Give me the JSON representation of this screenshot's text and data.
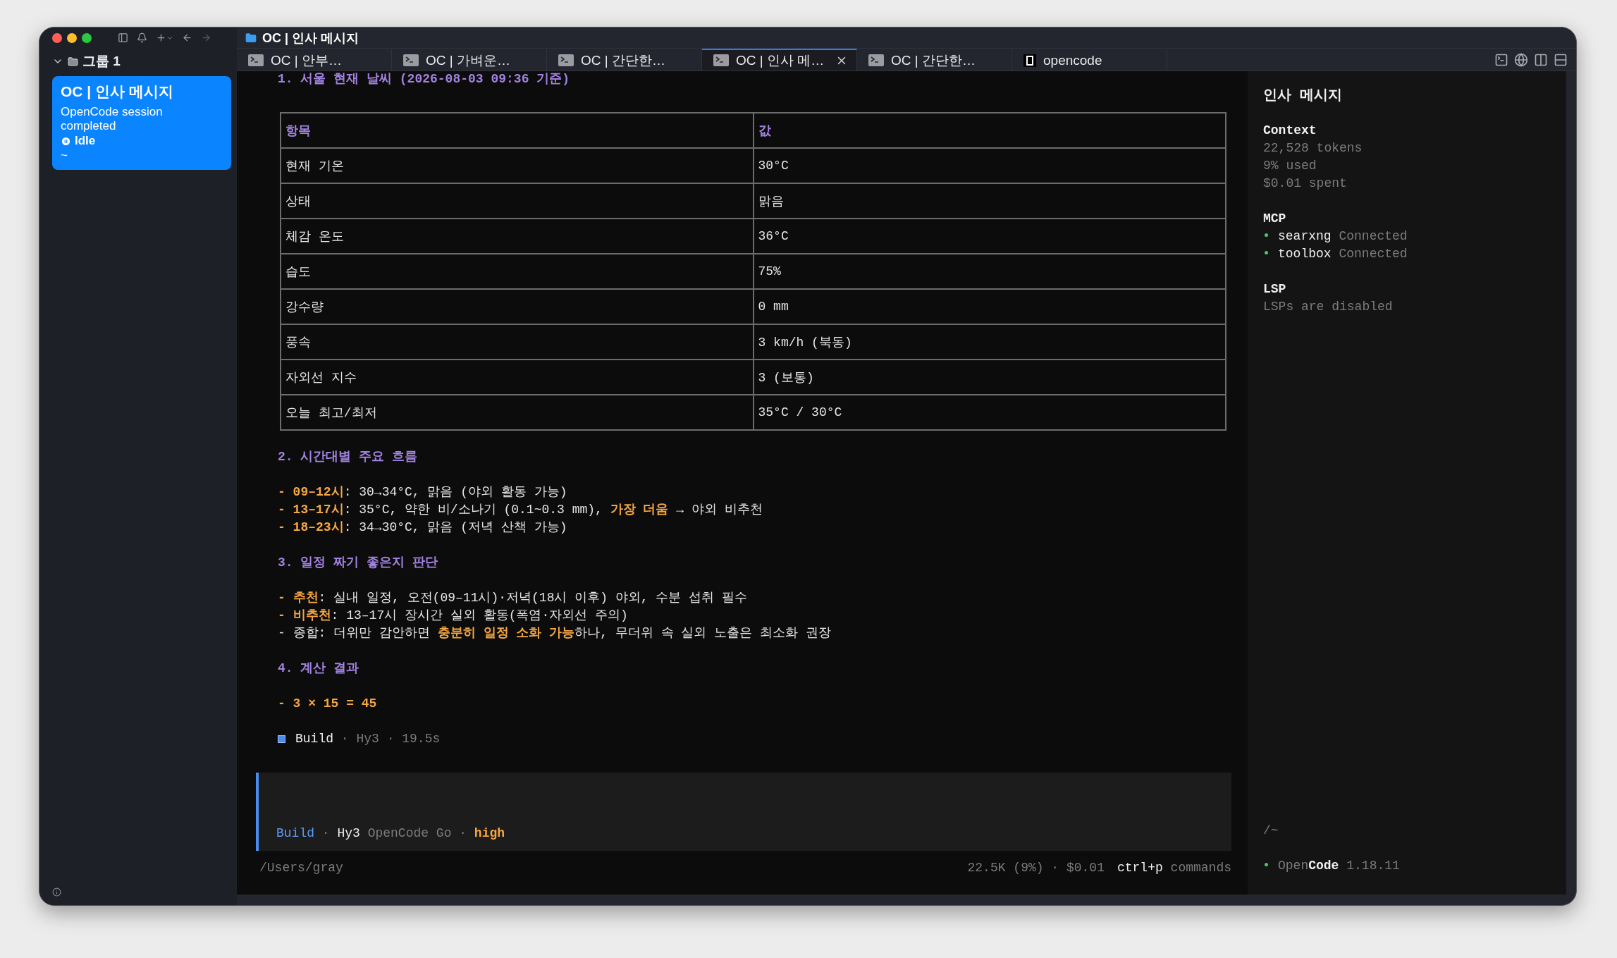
{
  "window": {
    "title": "OC | 인사 메시지"
  },
  "sidebar": {
    "group": {
      "label": "그룹 1",
      "expanded": true
    },
    "sessions": [
      {
        "title": "OC | 인사 메시지",
        "status_text": "OpenCode session completed",
        "state": "Idle",
        "path": "~",
        "selected": true
      }
    ]
  },
  "tabs": [
    {
      "label": "OC | 안부…",
      "kind": "terminal",
      "selected": false
    },
    {
      "label": "OC | 가벼운…",
      "kind": "terminal",
      "selected": false
    },
    {
      "label": "OC | 간단한…",
      "kind": "terminal",
      "selected": false
    },
    {
      "label": "OC | 인사 메…",
      "kind": "terminal",
      "selected": true
    },
    {
      "label": "OC | 간단한…",
      "kind": "terminal",
      "selected": false
    },
    {
      "label": "opencode",
      "kind": "app",
      "selected": false
    }
  ],
  "transcript": {
    "sections": [
      {
        "heading": "1. 서울 현재 날씨 (2026-08-03 09:36 기준)",
        "table": {
          "columns": [
            "항목",
            "값"
          ],
          "rows": [
            [
              "현재 기온",
              "30°C"
            ],
            [
              "상태",
              "맑음"
            ],
            [
              "체감 온도",
              "36°C"
            ],
            [
              "습도",
              "75%"
            ],
            [
              "강수량",
              "0 mm"
            ],
            [
              "풍속",
              "3 km/h (북동)"
            ],
            [
              "자외선 지수",
              "3 (보통)"
            ],
            [
              "오늘 최고/최저",
              "35°C / 30°C"
            ]
          ]
        }
      },
      {
        "heading": "2. 시간대별 주요 흐름",
        "lines": [
          [
            {
              "text": "- 09–12시",
              "kind": "em"
            },
            {
              "text": ": 30→34°C, 맑음 (야외 활동 가능)",
              "kind": "plain"
            }
          ],
          [
            {
              "text": "- 13–17시",
              "kind": "em"
            },
            {
              "text": ": 35°C, 약한 비/소나기 (0.1~0.3 mm), ",
              "kind": "plain"
            },
            {
              "text": "가장 더움",
              "kind": "em"
            },
            {
              "text": " → 야외 비추천",
              "kind": "plain"
            }
          ],
          [
            {
              "text": "- 18–23시",
              "kind": "em"
            },
            {
              "text": ": 34→30°C, 맑음 (저녁 산책 가능)",
              "kind": "plain"
            }
          ]
        ]
      },
      {
        "heading": "3. 일정 짜기 좋은지 판단",
        "lines": [
          [
            {
              "text": "- 추천",
              "kind": "em"
            },
            {
              "text": ": 실내 일정, 오전(09–11시)·저녁(18시 이후) 야외, 수분 섭취 필수",
              "kind": "plain"
            }
          ],
          [
            {
              "text": "- 비추천",
              "kind": "em"
            },
            {
              "text": ": 13–17시 장시간 실외 활동(폭염·자외선 주의)",
              "kind": "plain"
            }
          ],
          [
            {
              "text": "- 종합: 더위만 감안하면 ",
              "kind": "plain"
            },
            {
              "text": "충분히 일정 소화 가능",
              "kind": "em"
            },
            {
              "text": "하나, 무더위 속 실외 노출은 최소화 권장",
              "kind": "plain"
            }
          ]
        ]
      },
      {
        "heading": "4. 계산 결과",
        "lines": [
          [
            {
              "text": "- 3 × 15 = 45",
              "kind": "em"
            }
          ]
        ]
      }
    ],
    "meta": [
      {
        "text": "Build",
        "kind": "strong"
      },
      {
        "text": " · Hy3 · 19.5s",
        "kind": "muted"
      }
    ]
  },
  "prompt": {
    "footer": [
      {
        "text": "Build",
        "kind": "accent"
      },
      {
        "text": " · ",
        "kind": "muted"
      },
      {
        "text": "Hy3",
        "kind": "strong"
      },
      {
        "text": " OpenCode Go · ",
        "kind": "muted"
      },
      {
        "text": "high",
        "kind": "em"
      }
    ]
  },
  "status_bar": {
    "path": "/Users/gray",
    "usage": "22.5K (9%) · $0.01",
    "shortcut_key": "ctrl+p",
    "shortcut_label": "commands"
  },
  "info_panel": {
    "title": "인사 메시지",
    "context": {
      "label": "Context",
      "lines": [
        "22,528 tokens",
        "9% used",
        "$0.01 spent"
      ]
    },
    "mcp": {
      "label": "MCP",
      "servers": [
        {
          "name": "searxng",
          "status": "Connected"
        },
        {
          "name": "toolbox",
          "status": "Connected"
        }
      ]
    },
    "lsp": {
      "label": "LSP",
      "text": "LSPs are disabled"
    },
    "path": "/~",
    "app": {
      "name_muted": "Open",
      "name_strong": "Code",
      "version": "1.18.11"
    }
  }
}
